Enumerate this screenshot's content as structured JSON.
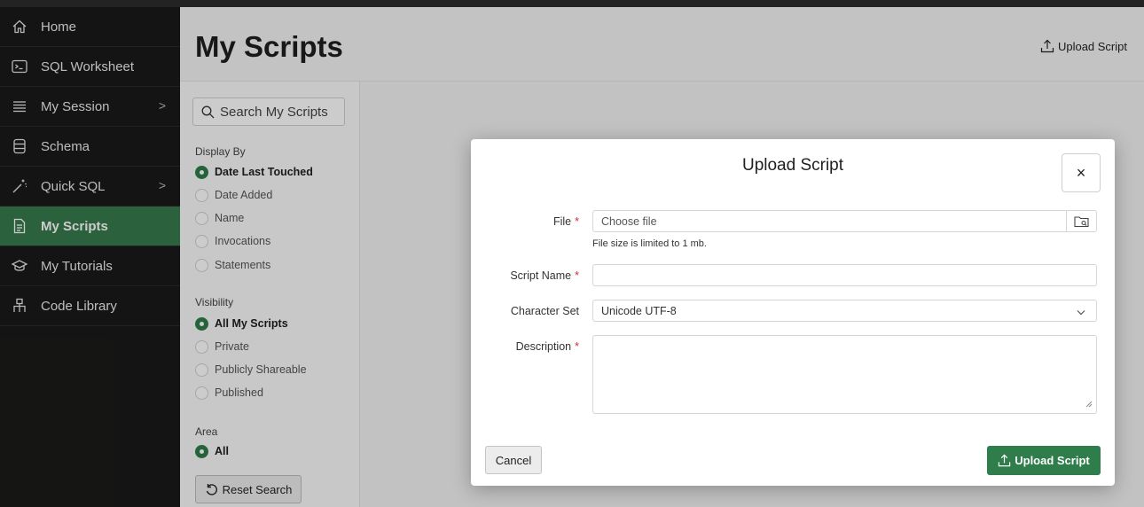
{
  "sidebar": {
    "items": [
      {
        "label": "Home",
        "icon": "home-icon"
      },
      {
        "label": "SQL Worksheet",
        "icon": "terminal-icon"
      },
      {
        "label": "My Session",
        "icon": "list-icon",
        "chevron": ">"
      },
      {
        "label": "Schema",
        "icon": "database-icon"
      },
      {
        "label": "Quick SQL",
        "icon": "magic-wand-icon",
        "chevron": ">"
      },
      {
        "label": "My Scripts",
        "icon": "document-icon",
        "active": true
      },
      {
        "label": "My Tutorials",
        "icon": "graduation-cap-icon"
      },
      {
        "label": "Code Library",
        "icon": "hierarchy-icon"
      }
    ]
  },
  "header": {
    "title": "My Scripts",
    "upload_label": "Upload Script"
  },
  "filters": {
    "search_placeholder": "Search My Scripts",
    "display_by": {
      "label": "Display By",
      "options": [
        "Date Last Touched",
        "Date Added",
        "Name",
        "Invocations",
        "Statements"
      ],
      "selected": "Date Last Touched"
    },
    "visibility": {
      "label": "Visibility",
      "options": [
        "All My Scripts",
        "Private",
        "Publicly Shareable",
        "Published"
      ],
      "selected": "All My Scripts"
    },
    "area": {
      "label": "Area",
      "options": [
        "All"
      ],
      "selected": "All"
    },
    "reset_label": "Reset Search"
  },
  "dialog": {
    "title": "Upload Script",
    "close_symbol": "×",
    "required_marker": "*",
    "file": {
      "label": "File",
      "placeholder": "Choose file",
      "hint": "File size is limited to 1 mb."
    },
    "script_name": {
      "label": "Script Name",
      "value": ""
    },
    "character_set": {
      "label": "Character Set",
      "value": "Unicode UTF-8"
    },
    "description": {
      "label": "Description",
      "value": ""
    },
    "cancel_label": "Cancel",
    "upload_label": "Upload Script"
  },
  "colors": {
    "accent_green": "#2f7d4a",
    "sidebar_bg": "#1a1a19",
    "required_red": "#d9293c"
  }
}
